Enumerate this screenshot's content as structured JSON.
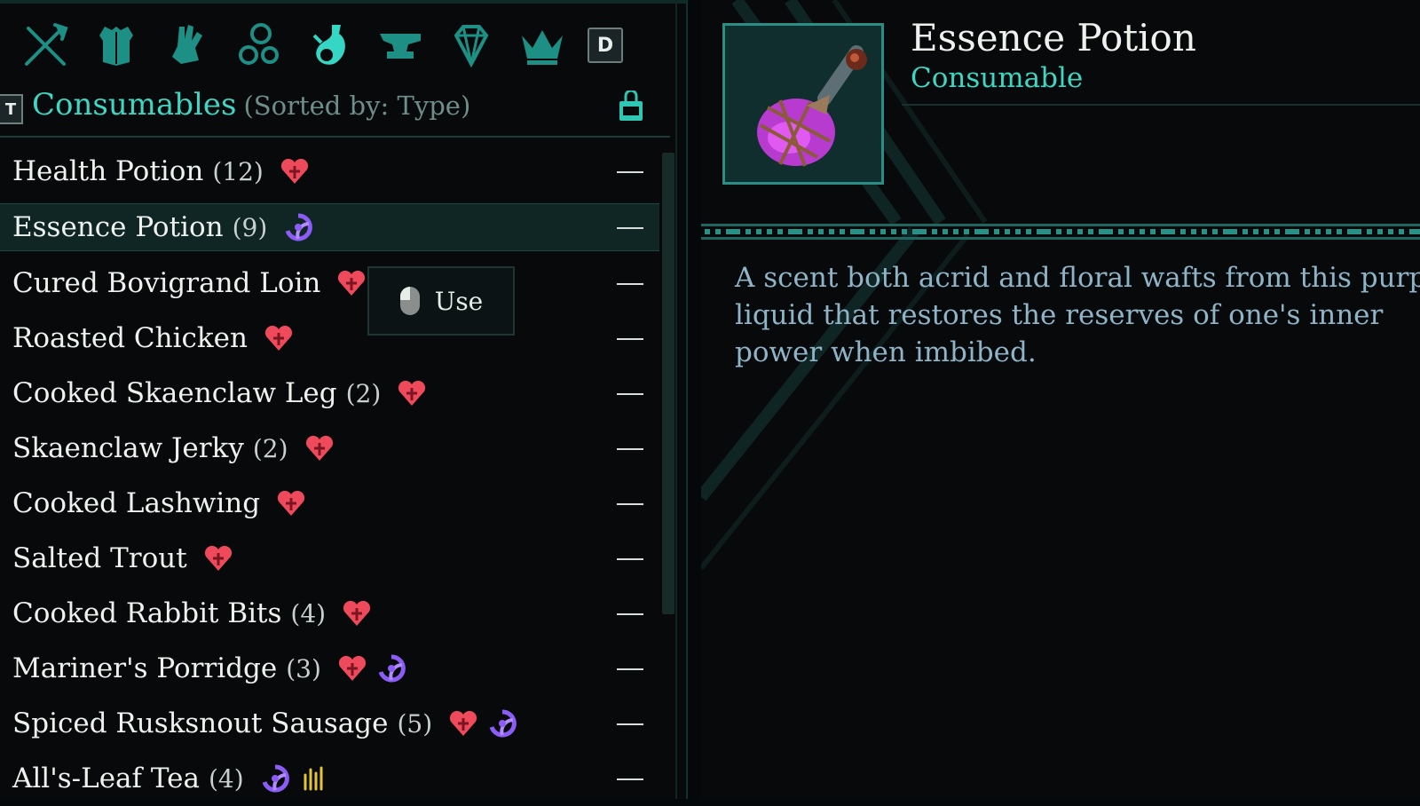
{
  "category_tabs": [
    {
      "icon": "crossed-weapons-icon"
    },
    {
      "icon": "armor-icon"
    },
    {
      "icon": "gauntlet-icon"
    },
    {
      "icon": "rings-icon"
    },
    {
      "icon": "potion-flask-icon",
      "active": true
    },
    {
      "icon": "anvil-icon"
    },
    {
      "icon": "gem-icon"
    },
    {
      "icon": "crown-icon"
    }
  ],
  "keys": {
    "next_category": "D",
    "prev_category": "T"
  },
  "header": {
    "title": "Consumables",
    "sort": "(Sorted by: Type)"
  },
  "items": [
    {
      "name": "Health Potion",
      "count": "(12)",
      "effects": [
        "health"
      ]
    },
    {
      "name": "Essence Potion",
      "count": "(9)",
      "effects": [
        "essence"
      ],
      "selected": true
    },
    {
      "name": "Cured Bovigrand Loin",
      "count": "",
      "effects": [
        "health"
      ]
    },
    {
      "name": "Roasted Chicken",
      "count": "",
      "effects": [
        "health"
      ]
    },
    {
      "name": "Cooked Skaenclaw Leg",
      "count": "(2)",
      "effects": [
        "health"
      ]
    },
    {
      "name": "Skaenclaw Jerky",
      "count": "(2)",
      "effects": [
        "health"
      ]
    },
    {
      "name": "Cooked Lashwing",
      "count": "",
      "effects": [
        "health"
      ]
    },
    {
      "name": "Salted Trout",
      "count": "",
      "effects": [
        "health"
      ]
    },
    {
      "name": "Cooked Rabbit Bits",
      "count": "(4)",
      "effects": [
        "health"
      ]
    },
    {
      "name": "Mariner's Porridge",
      "count": "(3)",
      "effects": [
        "health",
        "essence"
      ]
    },
    {
      "name": "Spiced Rusksnout Sausage",
      "count": "(5)",
      "effects": [
        "health",
        "essence"
      ]
    },
    {
      "name": "All's-Leaf Tea",
      "count": "(4)",
      "effects": [
        "essence",
        "stamina"
      ]
    }
  ],
  "tooltip": {
    "action": "Use",
    "icon": "mouse-icon"
  },
  "detail": {
    "title": "Essence Potion",
    "type": "Consumable",
    "description": "A scent both acrid and floral wafts from this purple liquid that restores the reserves of one's inner power when imbibed."
  },
  "colors": {
    "accent": "#3fd6c3",
    "health": "#ee4a5c",
    "essence": "#8b5cf6",
    "stamina": "#e3c43a"
  }
}
